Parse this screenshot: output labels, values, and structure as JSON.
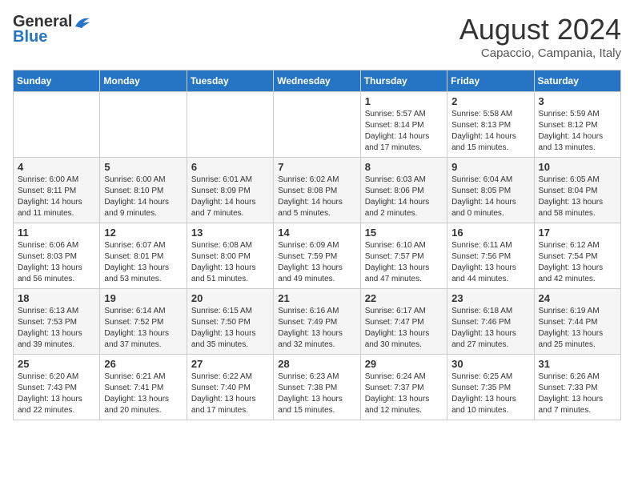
{
  "logo": {
    "general": "General",
    "blue": "Blue"
  },
  "title": "August 2024",
  "location": "Capaccio, Campania, Italy",
  "days_of_week": [
    "Sunday",
    "Monday",
    "Tuesday",
    "Wednesday",
    "Thursday",
    "Friday",
    "Saturday"
  ],
  "weeks": [
    [
      {
        "day": "",
        "info": ""
      },
      {
        "day": "",
        "info": ""
      },
      {
        "day": "",
        "info": ""
      },
      {
        "day": "",
        "info": ""
      },
      {
        "day": "1",
        "info": "Sunrise: 5:57 AM\nSunset: 8:14 PM\nDaylight: 14 hours and 17 minutes."
      },
      {
        "day": "2",
        "info": "Sunrise: 5:58 AM\nSunset: 8:13 PM\nDaylight: 14 hours and 15 minutes."
      },
      {
        "day": "3",
        "info": "Sunrise: 5:59 AM\nSunset: 8:12 PM\nDaylight: 14 hours and 13 minutes."
      }
    ],
    [
      {
        "day": "4",
        "info": "Sunrise: 6:00 AM\nSunset: 8:11 PM\nDaylight: 14 hours and 11 minutes."
      },
      {
        "day": "5",
        "info": "Sunrise: 6:00 AM\nSunset: 8:10 PM\nDaylight: 14 hours and 9 minutes."
      },
      {
        "day": "6",
        "info": "Sunrise: 6:01 AM\nSunset: 8:09 PM\nDaylight: 14 hours and 7 minutes."
      },
      {
        "day": "7",
        "info": "Sunrise: 6:02 AM\nSunset: 8:08 PM\nDaylight: 14 hours and 5 minutes."
      },
      {
        "day": "8",
        "info": "Sunrise: 6:03 AM\nSunset: 8:06 PM\nDaylight: 14 hours and 2 minutes."
      },
      {
        "day": "9",
        "info": "Sunrise: 6:04 AM\nSunset: 8:05 PM\nDaylight: 14 hours and 0 minutes."
      },
      {
        "day": "10",
        "info": "Sunrise: 6:05 AM\nSunset: 8:04 PM\nDaylight: 13 hours and 58 minutes."
      }
    ],
    [
      {
        "day": "11",
        "info": "Sunrise: 6:06 AM\nSunset: 8:03 PM\nDaylight: 13 hours and 56 minutes."
      },
      {
        "day": "12",
        "info": "Sunrise: 6:07 AM\nSunset: 8:01 PM\nDaylight: 13 hours and 53 minutes."
      },
      {
        "day": "13",
        "info": "Sunrise: 6:08 AM\nSunset: 8:00 PM\nDaylight: 13 hours and 51 minutes."
      },
      {
        "day": "14",
        "info": "Sunrise: 6:09 AM\nSunset: 7:59 PM\nDaylight: 13 hours and 49 minutes."
      },
      {
        "day": "15",
        "info": "Sunrise: 6:10 AM\nSunset: 7:57 PM\nDaylight: 13 hours and 47 minutes."
      },
      {
        "day": "16",
        "info": "Sunrise: 6:11 AM\nSunset: 7:56 PM\nDaylight: 13 hours and 44 minutes."
      },
      {
        "day": "17",
        "info": "Sunrise: 6:12 AM\nSunset: 7:54 PM\nDaylight: 13 hours and 42 minutes."
      }
    ],
    [
      {
        "day": "18",
        "info": "Sunrise: 6:13 AM\nSunset: 7:53 PM\nDaylight: 13 hours and 39 minutes."
      },
      {
        "day": "19",
        "info": "Sunrise: 6:14 AM\nSunset: 7:52 PM\nDaylight: 13 hours and 37 minutes."
      },
      {
        "day": "20",
        "info": "Sunrise: 6:15 AM\nSunset: 7:50 PM\nDaylight: 13 hours and 35 minutes."
      },
      {
        "day": "21",
        "info": "Sunrise: 6:16 AM\nSunset: 7:49 PM\nDaylight: 13 hours and 32 minutes."
      },
      {
        "day": "22",
        "info": "Sunrise: 6:17 AM\nSunset: 7:47 PM\nDaylight: 13 hours and 30 minutes."
      },
      {
        "day": "23",
        "info": "Sunrise: 6:18 AM\nSunset: 7:46 PM\nDaylight: 13 hours and 27 minutes."
      },
      {
        "day": "24",
        "info": "Sunrise: 6:19 AM\nSunset: 7:44 PM\nDaylight: 13 hours and 25 minutes."
      }
    ],
    [
      {
        "day": "25",
        "info": "Sunrise: 6:20 AM\nSunset: 7:43 PM\nDaylight: 13 hours and 22 minutes."
      },
      {
        "day": "26",
        "info": "Sunrise: 6:21 AM\nSunset: 7:41 PM\nDaylight: 13 hours and 20 minutes."
      },
      {
        "day": "27",
        "info": "Sunrise: 6:22 AM\nSunset: 7:40 PM\nDaylight: 13 hours and 17 minutes."
      },
      {
        "day": "28",
        "info": "Sunrise: 6:23 AM\nSunset: 7:38 PM\nDaylight: 13 hours and 15 minutes."
      },
      {
        "day": "29",
        "info": "Sunrise: 6:24 AM\nSunset: 7:37 PM\nDaylight: 13 hours and 12 minutes."
      },
      {
        "day": "30",
        "info": "Sunrise: 6:25 AM\nSunset: 7:35 PM\nDaylight: 13 hours and 10 minutes."
      },
      {
        "day": "31",
        "info": "Sunrise: 6:26 AM\nSunset: 7:33 PM\nDaylight: 13 hours and 7 minutes."
      }
    ]
  ]
}
